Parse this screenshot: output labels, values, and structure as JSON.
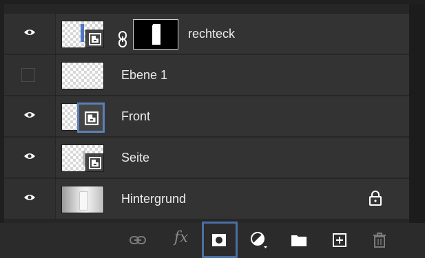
{
  "layers_panel": {
    "layers": [
      {
        "name": "rechteck",
        "visible": true,
        "thumbnail": "smart-object-thumbnail",
        "linked_mask": true
      },
      {
        "name": "Ebene 1",
        "visible": false,
        "thumbnail": "transparent-layer-thumbnail"
      },
      {
        "name": "Front",
        "visible": true,
        "thumbnail": "smart-object-thumbnail",
        "selected_thumbnail": true
      },
      {
        "name": "Seite",
        "visible": true,
        "thumbnail": "smart-object-thumbnail"
      },
      {
        "name": "Hintergrund",
        "visible": true,
        "thumbnail": "background-photo-thumbnail",
        "locked": true
      }
    ]
  },
  "bottom_toolbar": {
    "icons": [
      "link-layers-icon",
      "fx-icon",
      "add-mask-icon",
      "adjustment-layer-icon",
      "new-group-icon",
      "new-layer-icon",
      "trash-icon"
    ],
    "fx_label": "fx",
    "active": "add-mask-icon"
  },
  "colors": {
    "panel": "#333333",
    "selection_accent": "#5b80b8",
    "mask_button_frame": "#4b6fa3"
  }
}
